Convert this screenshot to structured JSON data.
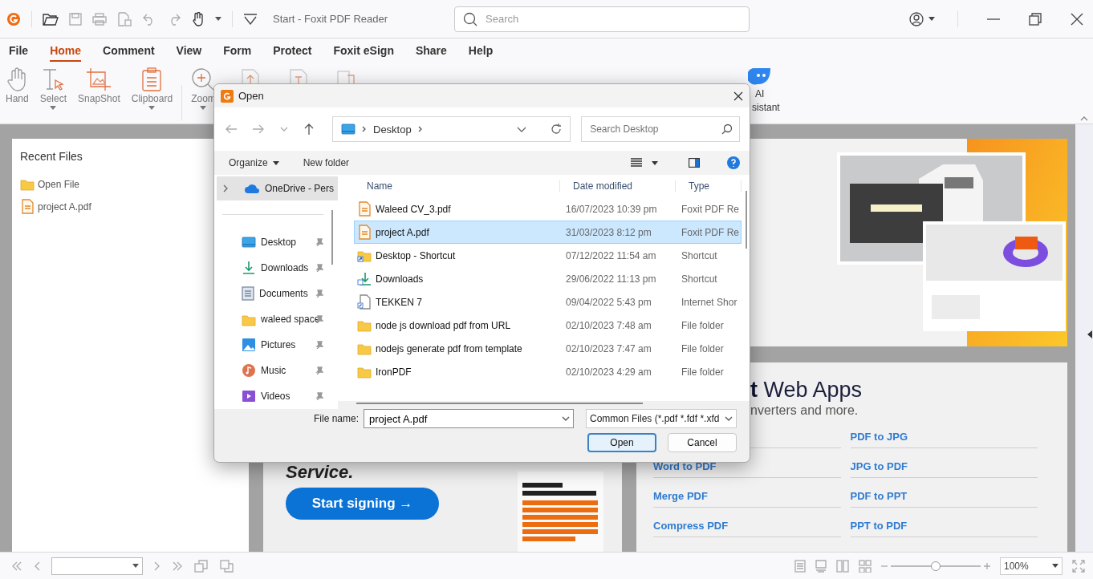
{
  "window": {
    "title": "Start - Foxit PDF Reader"
  },
  "search": {
    "placeholder": "Search"
  },
  "menu_tabs": [
    {
      "label": "File",
      "selected": false
    },
    {
      "label": "Home",
      "selected": true
    },
    {
      "label": "Comment",
      "selected": false
    },
    {
      "label": "View",
      "selected": false
    },
    {
      "label": "Form",
      "selected": false
    },
    {
      "label": "Protect",
      "selected": false
    },
    {
      "label": "Foxit eSign",
      "selected": false
    },
    {
      "label": "Share",
      "selected": false
    },
    {
      "label": "Help",
      "selected": false
    }
  ],
  "ribbon": {
    "tools": [
      {
        "kind": "hand",
        "label": "Hand",
        "dropdown": false
      },
      {
        "kind": "select",
        "label": "Select",
        "dropdown": true
      },
      {
        "kind": "snapshot",
        "label": "SnapShot",
        "dropdown": false
      },
      {
        "kind": "clipboard",
        "label": "Clipboard",
        "dropdown": true
      },
      {
        "kind": "zoom",
        "label": "Zoom",
        "dropdown": true
      }
    ],
    "ai_label": [
      "AI",
      "sistant"
    ]
  },
  "recent_files": {
    "title": "Recent Files",
    "items": [
      {
        "kind": "folder",
        "label": "Open File"
      },
      {
        "kind": "pdf",
        "label": "project A.pdf"
      }
    ]
  },
  "promo": {
    "heading": "Service.",
    "button": "Start signing →"
  },
  "web_apps": {
    "heading": "**t** Web Apps",
    "subtitle": "nverters and more.",
    "links_left": [
      "Word to PDF",
      "Merge PDF",
      "Compress PDF"
    ],
    "links_right": [
      "PDF to JPG",
      "JPG to PDF",
      "PDF to PPT",
      "PPT to PDF"
    ]
  },
  "dialog": {
    "title": "Open",
    "breadcrumb": "Desktop",
    "search_placeholder": "Search Desktop",
    "organize": "Organize",
    "new_folder": "New folder",
    "nav": [
      {
        "kind": "cloud",
        "label": "OneDrive - Pers",
        "selected": true,
        "pinned": false
      },
      {
        "kind": "desktop",
        "label": "Desktop",
        "selected": false,
        "pinned": true
      },
      {
        "kind": "download",
        "label": "Downloads",
        "selected": false,
        "pinned": true
      },
      {
        "kind": "documents",
        "label": "Documents",
        "selected": false,
        "pinned": true
      },
      {
        "kind": "folder",
        "label": "waleed space",
        "selected": false,
        "pinned": true
      },
      {
        "kind": "pictures",
        "label": "Pictures",
        "selected": false,
        "pinned": true
      },
      {
        "kind": "music",
        "label": "Music",
        "selected": false,
        "pinned": true
      },
      {
        "kind": "videos",
        "label": "Videos",
        "selected": false,
        "pinned": true
      }
    ],
    "columns": [
      "Name",
      "Date modified",
      "Type"
    ],
    "files": [
      {
        "kind": "pdf",
        "name": "Waleed CV_3.pdf",
        "date": "16/07/2023 10:39 pm",
        "type": "Foxit PDF Re",
        "selected": false
      },
      {
        "kind": "pdf",
        "name": "project A.pdf",
        "date": "31/03/2023 8:12 pm",
        "type": "Foxit PDF Re",
        "selected": true
      },
      {
        "kind": "folder-shortcut",
        "name": "Desktop - Shortcut",
        "date": "07/12/2022 11:54 am",
        "type": "Shortcut",
        "selected": false
      },
      {
        "kind": "download-shortcut",
        "name": "Downloads",
        "date": "29/06/2022 11:13 pm",
        "type": "Shortcut",
        "selected": false
      },
      {
        "kind": "file-shortcut",
        "name": "TEKKEN 7",
        "date": "09/04/2022 5:43 pm",
        "type": "Internet Shor",
        "selected": false
      },
      {
        "kind": "folder",
        "name": "node js download pdf from URL",
        "date": "02/10/2023 7:48 am",
        "type": "File folder",
        "selected": false
      },
      {
        "kind": "folder",
        "name": "nodejs generate pdf from template",
        "date": "02/10/2023 7:47 am",
        "type": "File folder",
        "selected": false
      },
      {
        "kind": "folder",
        "name": "IronPDF",
        "date": "02/10/2023 4:29 am",
        "type": "File folder",
        "selected": false
      }
    ],
    "file_name_label": "File name:",
    "file_name": "project A.pdf",
    "filter": "Common Files (*.pdf *.fdf *.xfd",
    "buttons": [
      {
        "label": "Open",
        "default": true
      },
      {
        "label": "Cancel",
        "default": false
      }
    ]
  },
  "status_bar": {
    "zoom_slider": {
      "level": 0.5
    },
    "zoom_value": "100%"
  }
}
